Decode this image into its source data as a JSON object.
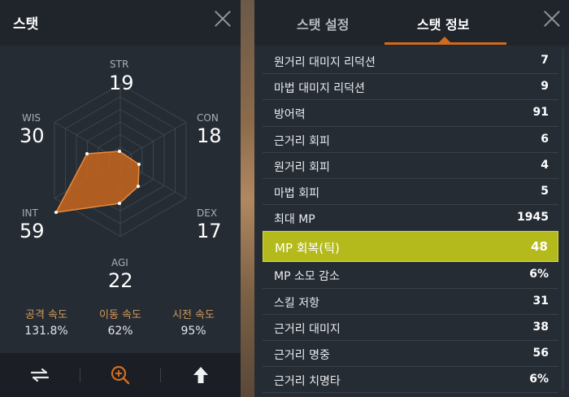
{
  "left_panel": {
    "title": "스탯",
    "stats": {
      "str": {
        "label": "STR",
        "value": "19"
      },
      "con": {
        "label": "CON",
        "value": "18"
      },
      "dex": {
        "label": "DEX",
        "value": "17"
      },
      "agi": {
        "label": "AGI",
        "value": "22"
      },
      "int": {
        "label": "INT",
        "value": "59"
      },
      "wis": {
        "label": "WIS",
        "value": "30"
      }
    },
    "speeds": [
      {
        "label": "공격 속도",
        "value": "131.8%"
      },
      {
        "label": "이동 속도",
        "value": "62%"
      },
      {
        "label": "시전 속도",
        "value": "95%"
      }
    ],
    "footer_icons": [
      "swap-icon",
      "zoom-in-icon",
      "upgrade-arrow-icon"
    ],
    "colors": {
      "accent": "#d36b1c",
      "radar_fill": "#c8661e",
      "speed_label": "#d19a5a"
    }
  },
  "right_panel": {
    "tabs": [
      {
        "label": "스탯 설정",
        "active": false
      },
      {
        "label": "스탯 정보",
        "active": true
      }
    ],
    "rows": [
      {
        "label": "원거리 대미지 리덕션",
        "value": "7"
      },
      {
        "label": "마법 대미지 리덕션",
        "value": "9"
      },
      {
        "label": "방어력",
        "value": "91"
      },
      {
        "label": "근거리 회피",
        "value": "6"
      },
      {
        "label": "원거리 회피",
        "value": "4"
      },
      {
        "label": "마법 회피",
        "value": "5"
      },
      {
        "label": "최대 MP",
        "value": "1945"
      },
      {
        "label": "MP 회복(틱)",
        "value": "48"
      },
      {
        "label": "MP 소모 감소",
        "value": "6%"
      },
      {
        "label": "스킬 저항",
        "value": "31"
      },
      {
        "label": "근거리 대미지",
        "value": "38"
      },
      {
        "label": "근거리 명중",
        "value": "56"
      },
      {
        "label": "근거리 치명타",
        "value": "6%"
      }
    ],
    "highlight_color": "#b5ba1c"
  }
}
